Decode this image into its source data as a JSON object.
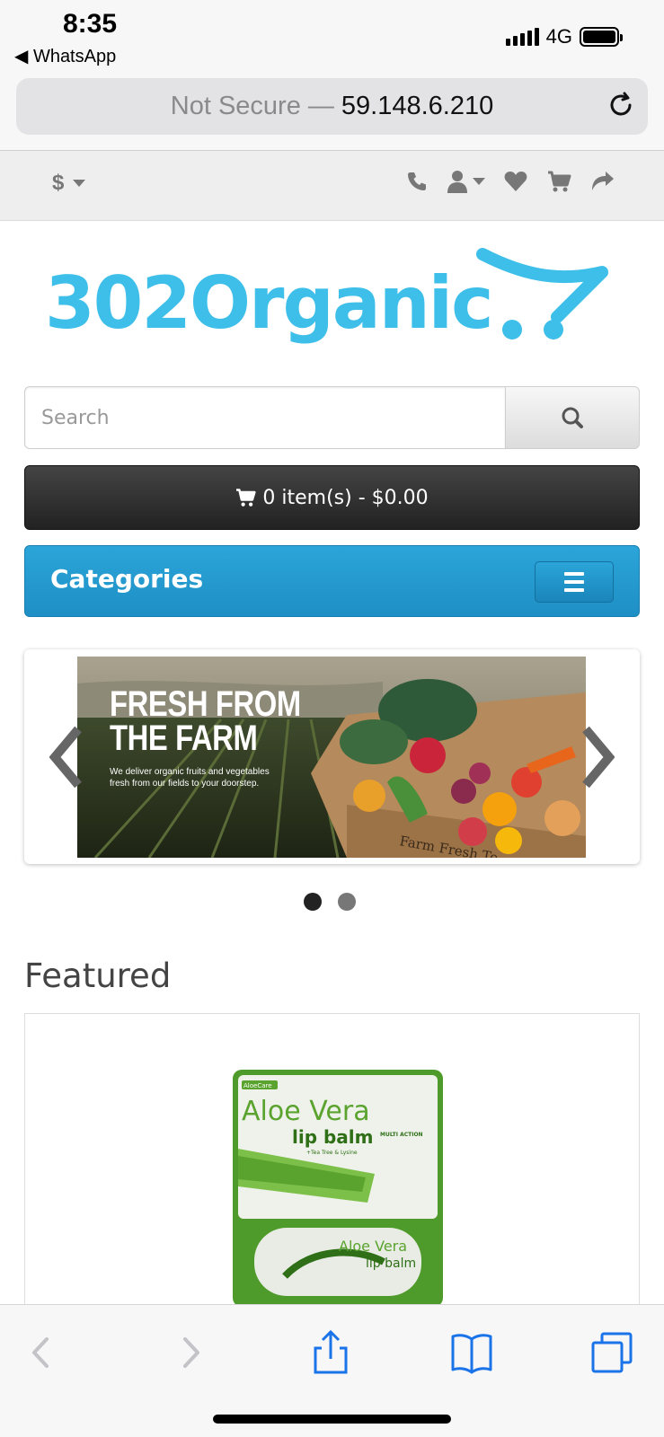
{
  "status_bar": {
    "time": "8:35",
    "back_app": "◀ WhatsApp",
    "network": "4G"
  },
  "url_bar": {
    "security": "Not Secure —",
    "host": "59.148.6.210"
  },
  "store_nav": {
    "currency": "$",
    "icons": [
      "phone-icon",
      "user-icon",
      "heart-icon",
      "cart-icon",
      "share-icon"
    ]
  },
  "logo": {
    "text": "302Organic",
    "color": "#3dbfea"
  },
  "search": {
    "placeholder": "Search"
  },
  "cart": {
    "label": "0 item(s) - $0.00"
  },
  "categories": {
    "label": "Categories"
  },
  "slideshow": {
    "headline_line1": "FRESH FROM",
    "headline_line2": "THE FARM",
    "subtext": "We deliver organic fruits and vegetables fresh from our fields to your doorstep.",
    "box_text": "Farm Fresh To",
    "slide_count": 2,
    "active_slide": 1
  },
  "featured": {
    "title": "Featured",
    "product": {
      "brand": "AloeCare",
      "name_line1": "Aloe Vera",
      "name_line2": "lip balm",
      "name_line3": "+Tea Tree & Lysine",
      "badge": "MULTI ACTION"
    }
  },
  "colors": {
    "accent_blue": "#2ba5d9",
    "cart_dark": "#2b2b2b",
    "ios_blue": "#1a73e8"
  }
}
